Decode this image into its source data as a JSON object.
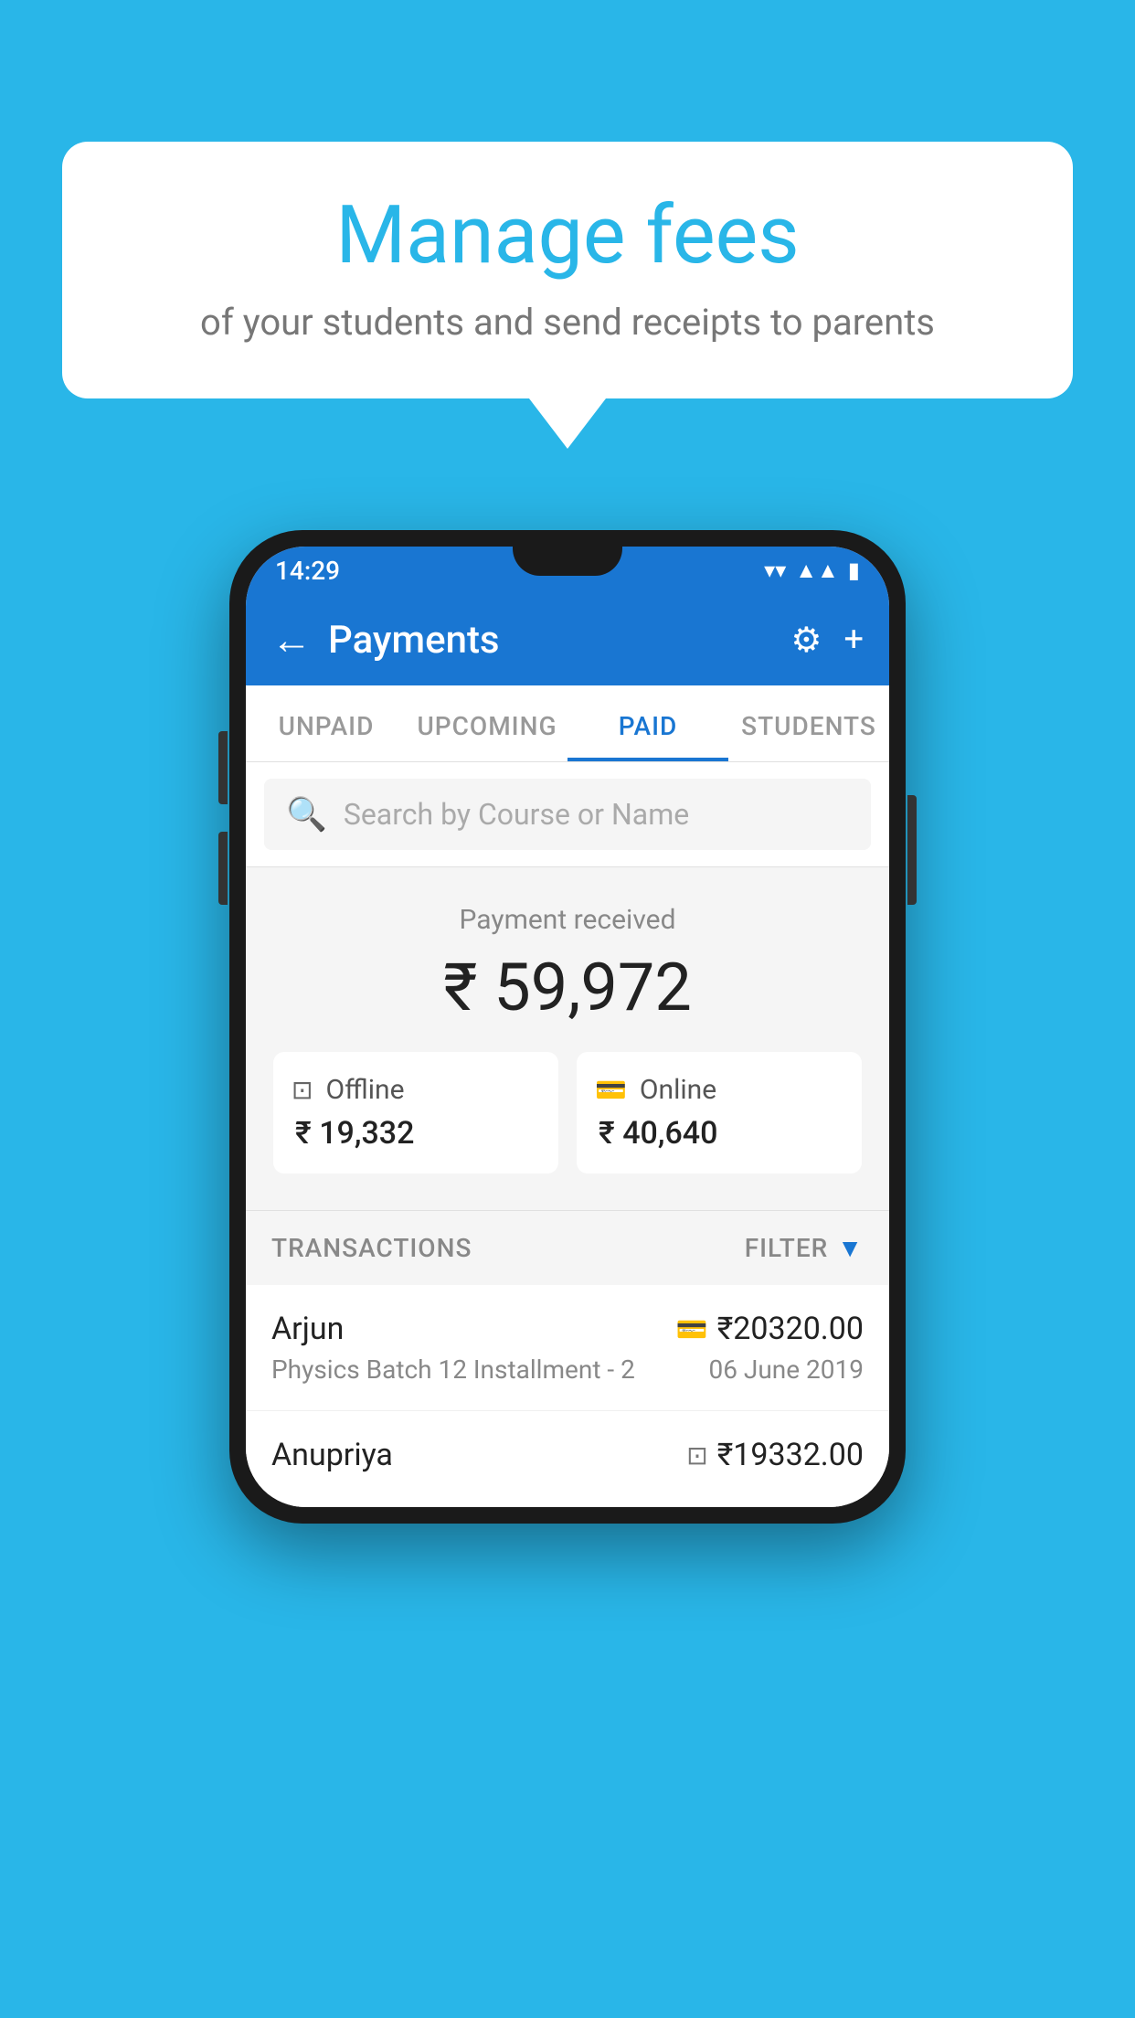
{
  "background_color": "#29b6e8",
  "speech_bubble": {
    "title": "Manage fees",
    "subtitle": "of your students and send receipts to parents"
  },
  "status_bar": {
    "time": "14:29",
    "icons": [
      "wifi",
      "signal",
      "battery"
    ]
  },
  "app_bar": {
    "title": "Payments",
    "back_label": "←",
    "settings_label": "⚙",
    "add_label": "+"
  },
  "tabs": [
    {
      "label": "UNPAID",
      "active": false
    },
    {
      "label": "UPCOMING",
      "active": false
    },
    {
      "label": "PAID",
      "active": true
    },
    {
      "label": "STUDENTS",
      "active": false
    }
  ],
  "search": {
    "placeholder": "Search by Course or Name"
  },
  "payment_summary": {
    "label": "Payment received",
    "total": "₹ 59,972",
    "offline": {
      "label": "Offline",
      "amount": "₹ 19,332"
    },
    "online": {
      "label": "Online",
      "amount": "₹ 40,640"
    }
  },
  "transactions": {
    "label": "TRANSACTIONS",
    "filter_label": "FILTER",
    "items": [
      {
        "name": "Arjun",
        "amount": "₹20320.00",
        "course": "Physics Batch 12 Installment - 2",
        "date": "06 June 2019",
        "payment_type": "card"
      },
      {
        "name": "Anupriya",
        "amount": "₹19332.00",
        "course": "",
        "date": "",
        "payment_type": "offline"
      }
    ]
  }
}
